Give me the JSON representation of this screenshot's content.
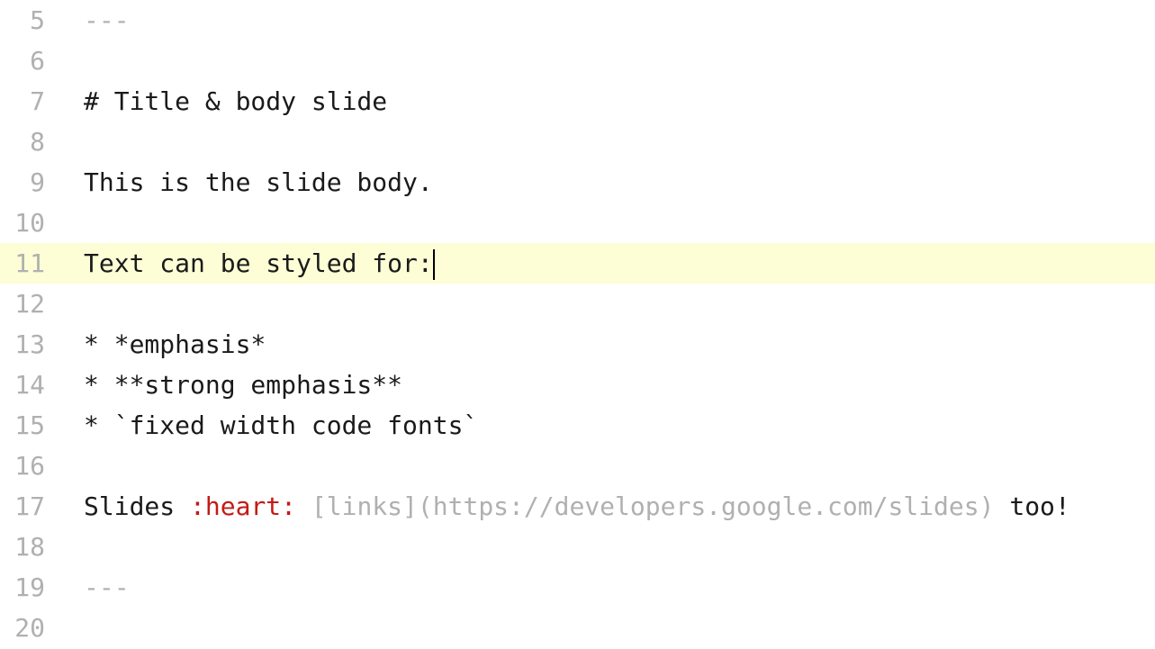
{
  "colors": {
    "highlight": "#fdfdd6",
    "gutter": "#b0b0b0",
    "emoji": "#c41a16",
    "linkMuted": "#b0b0b0",
    "text": "#1a1a1a"
  },
  "cursorLine": 11,
  "lines": [
    {
      "num": "5",
      "segments": [
        {
          "cls": "md-punct",
          "text": "---"
        }
      ]
    },
    {
      "num": "6",
      "segments": [
        {
          "cls": "",
          "text": ""
        }
      ]
    },
    {
      "num": "7",
      "segments": [
        {
          "cls": "md-hash",
          "text": "# Title & body slide"
        }
      ]
    },
    {
      "num": "8",
      "segments": [
        {
          "cls": "",
          "text": ""
        }
      ]
    },
    {
      "num": "9",
      "segments": [
        {
          "cls": "",
          "text": "This is the slide body."
        }
      ]
    },
    {
      "num": "10",
      "segments": [
        {
          "cls": "",
          "text": ""
        }
      ]
    },
    {
      "num": "11",
      "current": true,
      "cursorAfter": true,
      "segments": [
        {
          "cls": "",
          "text": "Text can be styled for:"
        }
      ]
    },
    {
      "num": "12",
      "segments": [
        {
          "cls": "",
          "text": ""
        }
      ]
    },
    {
      "num": "13",
      "segments": [
        {
          "cls": "",
          "text": "* *emphasis*"
        }
      ]
    },
    {
      "num": "14",
      "segments": [
        {
          "cls": "",
          "text": "* **strong emphasis**"
        }
      ]
    },
    {
      "num": "15",
      "segments": [
        {
          "cls": "",
          "text": "* `fixed width code fonts`"
        }
      ]
    },
    {
      "num": "16",
      "segments": [
        {
          "cls": "",
          "text": ""
        }
      ]
    },
    {
      "num": "17",
      "segments": [
        {
          "cls": "",
          "text": "Slides "
        },
        {
          "cls": "emoji",
          "text": ":heart:"
        },
        {
          "cls": "",
          "text": " "
        },
        {
          "cls": "link-gray",
          "text": "[links](https://developers.google.com/slides)"
        },
        {
          "cls": "",
          "text": " too!"
        }
      ]
    },
    {
      "num": "18",
      "segments": [
        {
          "cls": "",
          "text": ""
        }
      ]
    },
    {
      "num": "19",
      "segments": [
        {
          "cls": "md-punct",
          "text": "---"
        }
      ]
    },
    {
      "num": "20",
      "segments": [
        {
          "cls": "",
          "text": ""
        }
      ]
    }
  ]
}
